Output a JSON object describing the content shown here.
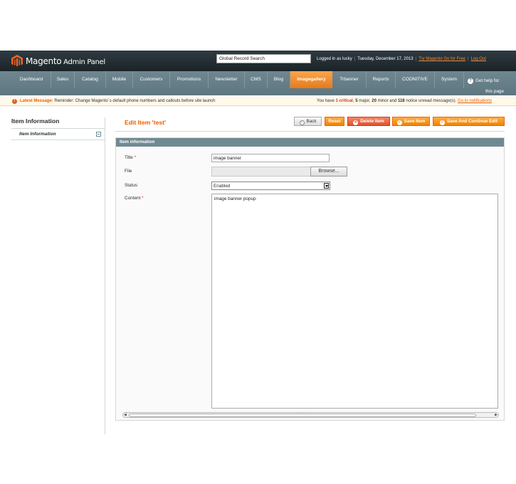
{
  "header": {
    "brand": "Magento",
    "brand_sub": "Admin Panel",
    "search_value": "Global Record Search",
    "logged_in": "Logged in as lucky",
    "date": "Tuesday, December 17, 2013",
    "try_link": "Try Magento Go for Free",
    "logout_link": "Log Out"
  },
  "nav": {
    "items": [
      "Dashboard",
      "Sales",
      "Catalog",
      "Mobile",
      "Customers",
      "Promotions",
      "Newsletter",
      "CMS",
      "Blog",
      "Imagegallery",
      "Trbanner",
      "Reports",
      "CODNITIVE",
      "System"
    ],
    "active": "Imagegallery",
    "help_line1": "Get help for",
    "help_line2": "this page"
  },
  "notice": {
    "label": "Latest Message:",
    "message": "Reminder: Change Magento`s default phone numbers and callouts before site launch",
    "you_have": "You have",
    "critical_count": "1",
    "critical_label": "critical",
    "major_count": "5",
    "major_label": "major,",
    "minor_count": "20",
    "minor_label": "minor and",
    "notice_count": "118",
    "notice_label": "notice unread message(s).",
    "link": "Go to notifications"
  },
  "sidebar": {
    "title": "Item Information",
    "tab_label": "Item Information"
  },
  "content": {
    "title": "Edit Item 'test'",
    "buttons": {
      "back": "Back",
      "reset": "Reset",
      "delete": "Delete Item",
      "save": "Save Item",
      "save_continue": "Save And Continue Edit"
    }
  },
  "form": {
    "section_title": "Item information",
    "title_label": "Title",
    "title_value": "image banner",
    "file_label": "File",
    "browse_label": "Browse...",
    "status_label": "Status",
    "status_value": "Enabled",
    "content_label": "Content",
    "content_value": "image banner popup",
    "required_mark": "*"
  },
  "colors": {
    "accent": "#eb5e00",
    "nav_bg": "#6f8791",
    "header_bg": "#1f292d"
  }
}
